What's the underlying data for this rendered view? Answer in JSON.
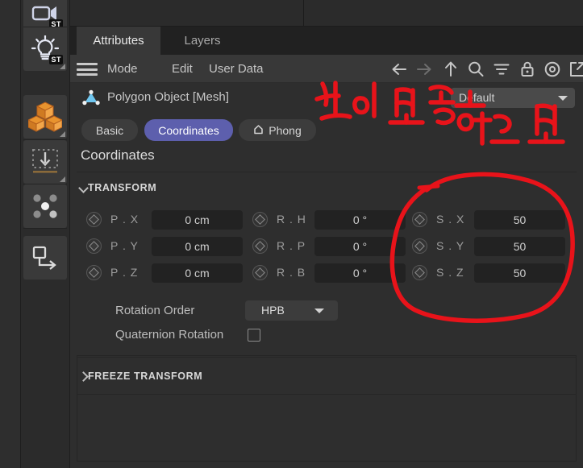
{
  "app": {
    "theme_bg": "#2b2b2b",
    "accent": "#5d5fad",
    "ink_color": "#e8131a"
  },
  "left_toolbar": {
    "items": [
      {
        "name": "camera-object-tool",
        "icon": "camera-icon",
        "badge": "ST"
      },
      {
        "name": "light-object-tool",
        "icon": "light-bulb-icon",
        "badge": "ST"
      },
      {
        "name": "primitive-object-tool",
        "icon": "cubes-icon",
        "badge": ""
      },
      {
        "name": "drop-to-floor-tool",
        "icon": "arrow-down-to-plane-icon",
        "badge": ""
      },
      {
        "name": "array-tool",
        "icon": "five-dots-icon",
        "badge": ""
      },
      {
        "name": "instance-tool",
        "icon": "square-arrow-icon",
        "badge": ""
      }
    ]
  },
  "tabs": [
    {
      "label": "Attributes",
      "active": true
    },
    {
      "label": "Layers",
      "active": false
    }
  ],
  "menu": {
    "hamburger": "menu-icon",
    "items": [
      "Mode",
      "Edit",
      "User Data"
    ],
    "toolbar_icons": [
      "back-arrow-icon",
      "forward-arrow-icon",
      "up-arrow-icon",
      "search-icon",
      "filter-icon",
      "lock-icon",
      "target-record-icon",
      "open-external-icon"
    ]
  },
  "object": {
    "icon": "polygon-object-icon",
    "title": "Polygon Object [Mesh]",
    "preset": {
      "value": "Default",
      "dropdown_icon": "chevron-down-icon"
    }
  },
  "attribute_tabs": [
    {
      "label": "Basic",
      "selected": false,
      "icon": ""
    },
    {
      "label": "Coordinates",
      "selected": true,
      "icon": ""
    },
    {
      "label": "Phong",
      "selected": false,
      "icon": "phong-tag-icon"
    }
  ],
  "page_title": "Coordinates",
  "transform": {
    "group_label": "TRANSFORM",
    "expanded": true,
    "rows": [
      {
        "position": {
          "keyframe_icon": "keyframe-diamond-icon",
          "label": "P . X",
          "value": "0 cm"
        },
        "rotation": {
          "keyframe_icon": "keyframe-diamond-icon",
          "label": "R . H",
          "value": "0 °"
        },
        "scale": {
          "keyframe_icon": "keyframe-diamond-icon",
          "label": "S . X",
          "value": "50"
        }
      },
      {
        "position": {
          "keyframe_icon": "keyframe-diamond-icon",
          "label": "P . Y",
          "value": "0 cm"
        },
        "rotation": {
          "keyframe_icon": "keyframe-diamond-icon",
          "label": "R . P",
          "value": "0 °"
        },
        "scale": {
          "keyframe_icon": "keyframe-diamond-icon",
          "label": "S . Y",
          "value": "50"
        }
      },
      {
        "position": {
          "keyframe_icon": "keyframe-diamond-icon",
          "label": "P . Z",
          "value": "0 cm"
        },
        "rotation": {
          "keyframe_icon": "keyframe-diamond-icon",
          "label": "R . B",
          "value": "0 °"
        },
        "scale": {
          "keyframe_icon": "keyframe-diamond-icon",
          "label": "S . Z",
          "value": "50"
        }
      }
    ],
    "rotation_order": {
      "label": "Rotation Order",
      "value": "HPB",
      "dropdown_icon": "chevron-down-icon"
    },
    "quaternion": {
      "label": "Quaternion Rotation",
      "checked": false
    }
  },
  "freeze_transform": {
    "group_label": "FREEZE TRANSFORM",
    "expanded": false
  },
  "annotations": {
    "handwriting": "같이 변경하는 법",
    "circle_target": "scale-fields-group",
    "color": "#e8131a"
  }
}
